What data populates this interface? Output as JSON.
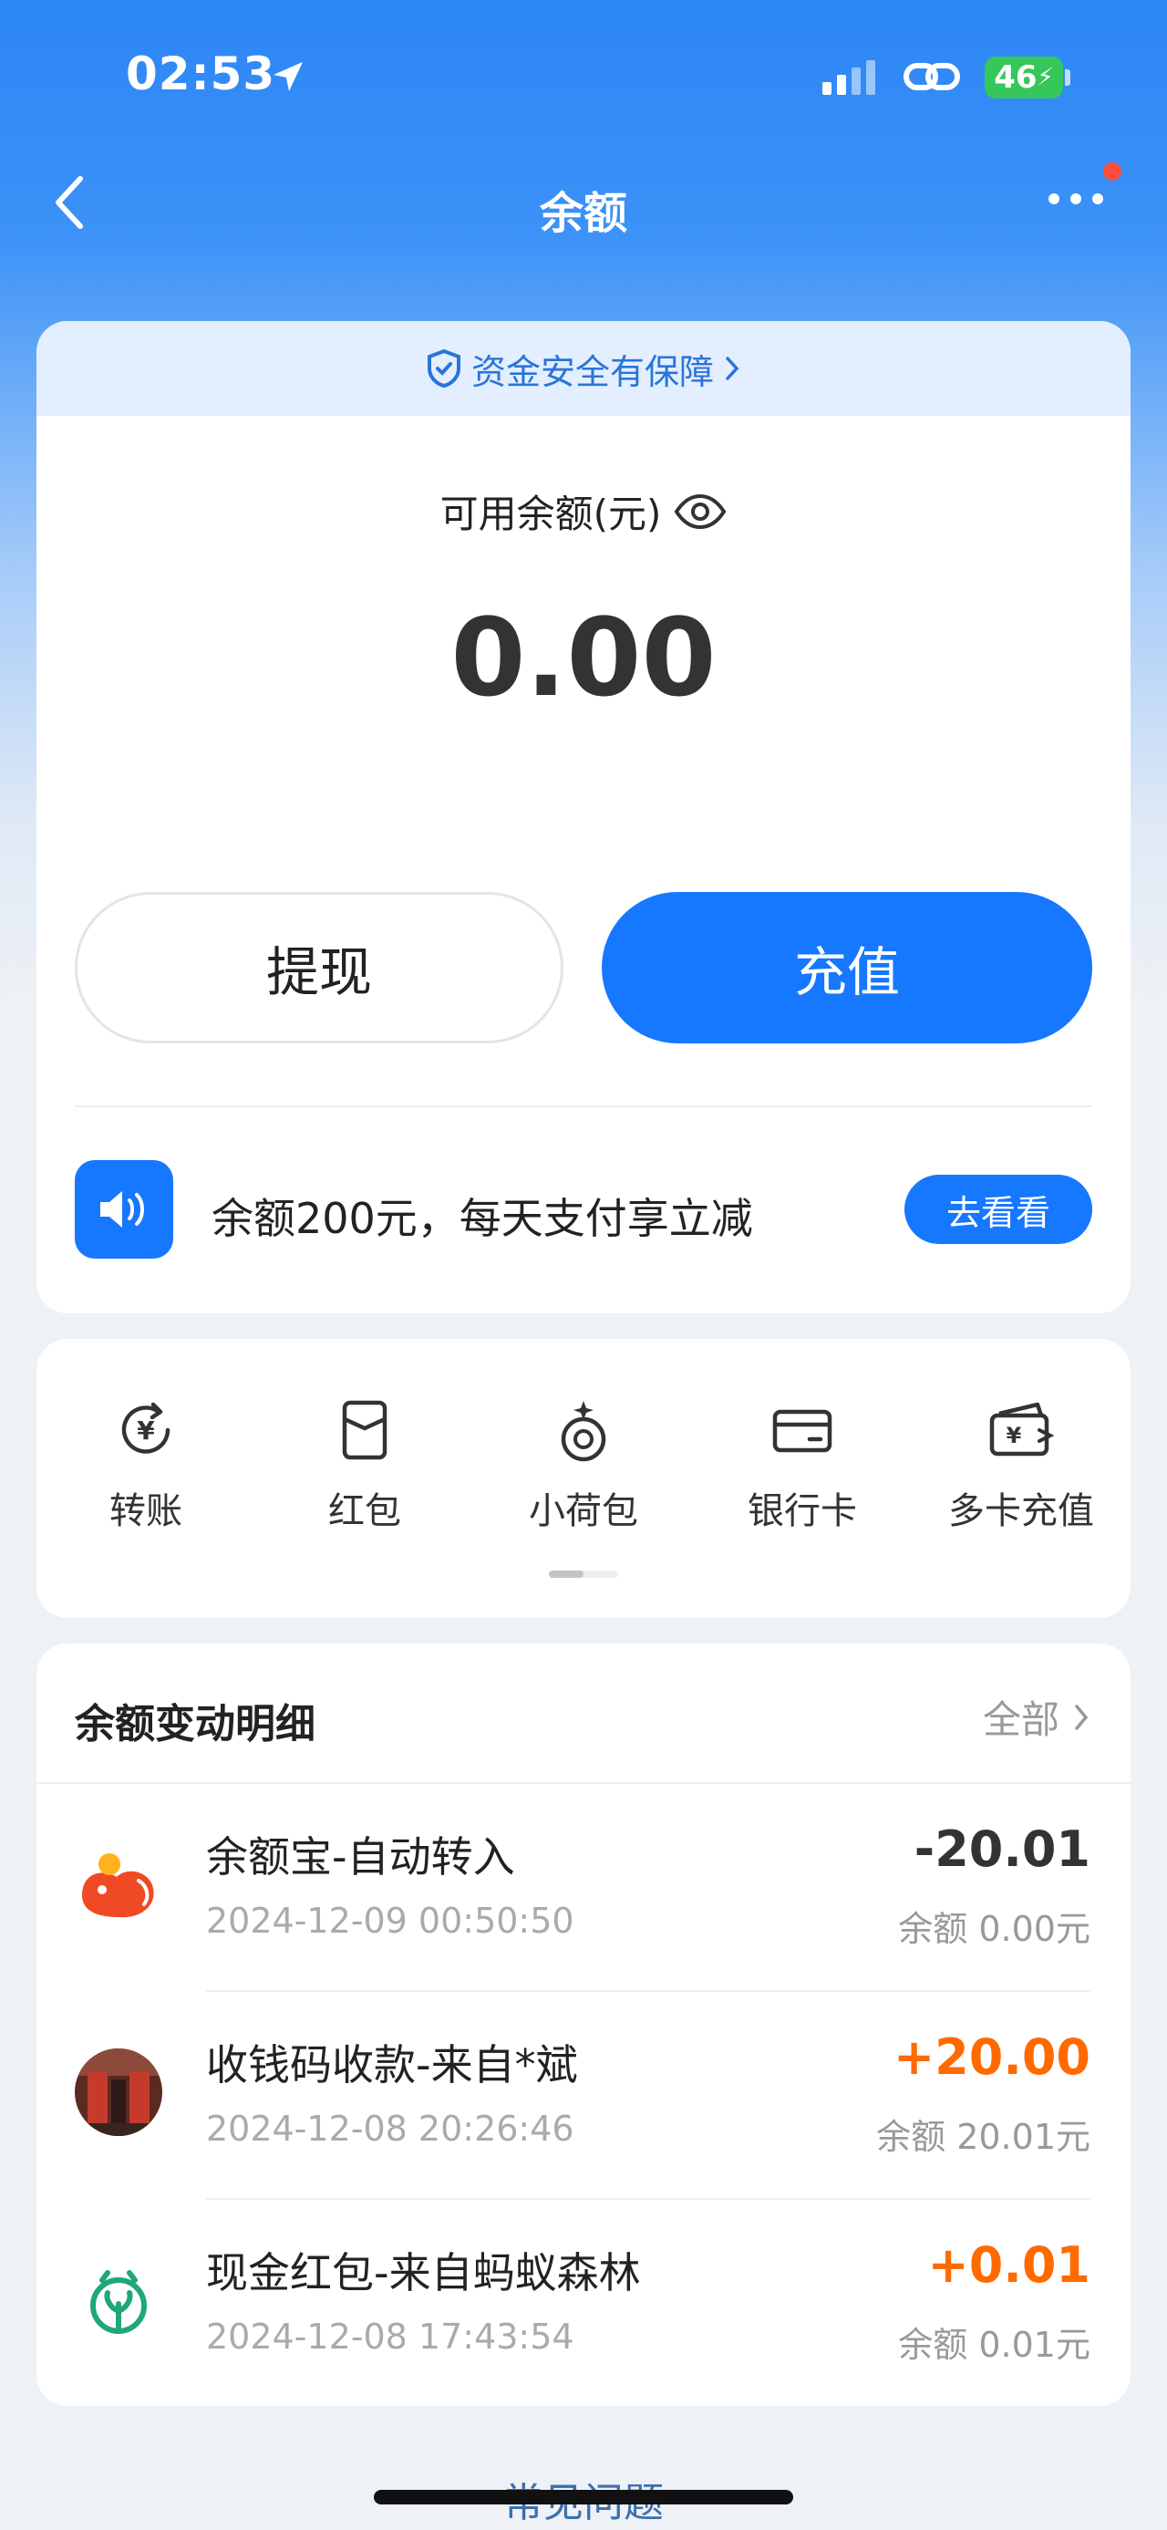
{
  "status_bar": {
    "time": "02:53",
    "battery": "46"
  },
  "nav": {
    "title": "余额"
  },
  "balance": {
    "safety_banner": "资金安全有保障",
    "available_label": "可用余额(元)",
    "amount": "0.00",
    "withdraw_label": "提现",
    "recharge_label": "充值"
  },
  "promo": {
    "text": "余额200元，每天支付享立减",
    "button": "去看看"
  },
  "actions": [
    {
      "label": "转账",
      "icon": "transfer-icon"
    },
    {
      "label": "红包",
      "icon": "red-packet-icon"
    },
    {
      "label": "小荷包",
      "icon": "small-pouch-icon"
    },
    {
      "label": "银行卡",
      "icon": "bank-card-icon"
    },
    {
      "label": "多卡充值",
      "icon": "multi-card-recharge-icon"
    }
  ],
  "transactions": {
    "title": "余额变动明细",
    "all_label": "全部",
    "items": [
      {
        "name": "余额宝-自动转入",
        "time": "2024-12-09 00:50:50",
        "amount": "-20.01",
        "amount_color": "#333333",
        "balance": "余额 0.00元"
      },
      {
        "name": "收钱码收款-来自*斌",
        "time": "2024-12-08 20:26:46",
        "amount": "+20.00",
        "amount_color": "#ff6a00",
        "balance": "余额 20.01元"
      },
      {
        "name": "现金红包-来自蚂蚁森林",
        "time": "2024-12-08 17:43:54",
        "amount": "+0.01",
        "amount_color": "#ff6a00",
        "balance": "余额 0.01元"
      }
    ]
  },
  "footer": {
    "faq": "常见问题"
  },
  "colors": {
    "primary": "#1677ff",
    "income": "#ff6a00",
    "badge": "#ff4f3b"
  }
}
